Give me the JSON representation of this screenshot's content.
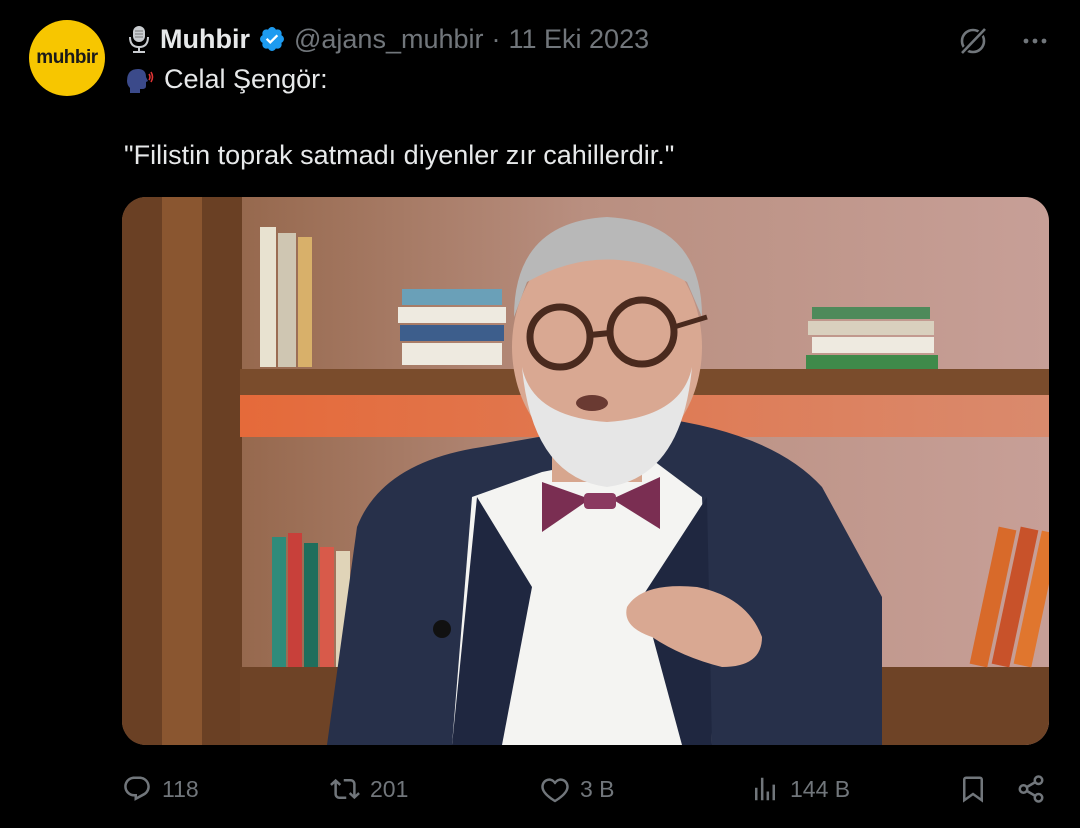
{
  "tweet": {
    "avatar_text": "muhbir",
    "display_name": "Muhbir",
    "handle": "@ajans_muhbir",
    "separator": "·",
    "date": "11 Eki 2023",
    "speaker_line": "Celal Şengör:",
    "quote": "\"Filistin toprak satmadı diyenler zır cahillerdir.\"",
    "media_icon": "photo-of-speaker-in-studio"
  },
  "actions": {
    "replies": "118",
    "reposts": "201",
    "likes": "3 B",
    "views": "144 B"
  },
  "colors": {
    "background": "#000000",
    "text": "#e7e9ea",
    "muted": "#71767b",
    "verified": "#1d9bf0",
    "avatar": "#f7c600"
  },
  "icons": [
    "microphone-icon",
    "verified-icon",
    "grok-icon",
    "more-icon",
    "speaking-head-icon",
    "reply-icon",
    "repost-icon",
    "like-icon",
    "views-icon",
    "bookmark-icon",
    "share-icon"
  ]
}
